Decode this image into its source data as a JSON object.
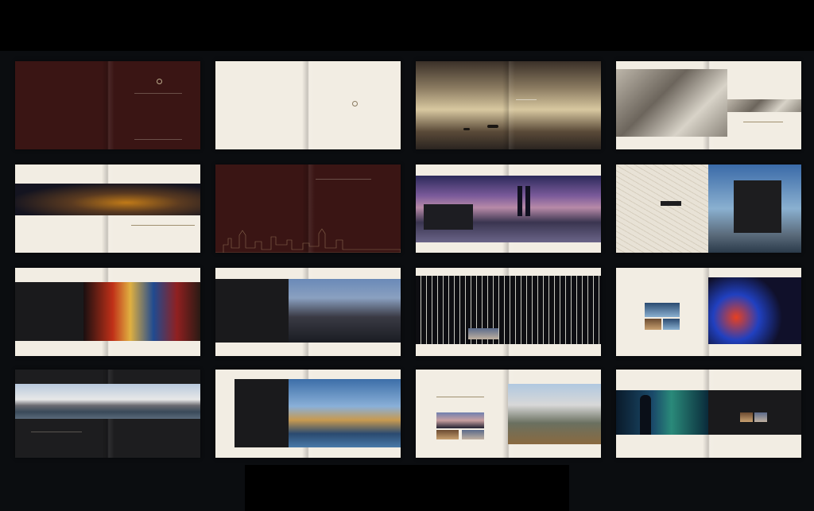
{
  "layout": {
    "background": "#0b0d10",
    "columns": 4,
    "rows": 4
  },
  "colors": {
    "cream": "#f2ede3",
    "maroon": "#3a1514",
    "dark_panel": "#1d1d1f",
    "gold": "#b9a98a"
  },
  "spreads": [
    {
      "id": "cover",
      "style": "maroon",
      "captions": []
    },
    {
      "id": "blank-logo",
      "style": "cream",
      "captions": []
    },
    {
      "id": "river-sunset",
      "style": "photo",
      "captions": []
    },
    {
      "id": "historic-collage",
      "style": "cream",
      "captions": []
    },
    {
      "id": "night-bridge",
      "style": "cream",
      "captions": []
    },
    {
      "id": "maroon-skyline",
      "style": "maroon",
      "captions": []
    },
    {
      "id": "twin-towers",
      "style": "cream",
      "captions": []
    },
    {
      "id": "map-city",
      "style": "cream",
      "captions": []
    },
    {
      "id": "times-square",
      "style": "cream",
      "captions": []
    },
    {
      "id": "towers-day",
      "style": "cream",
      "captions": []
    },
    {
      "id": "office-night",
      "style": "cream",
      "captions": []
    },
    {
      "id": "light-trails",
      "style": "cream",
      "captions": []
    },
    {
      "id": "skyline-panorama",
      "style": "dark",
      "captions": []
    },
    {
      "id": "island-city",
      "style": "cream",
      "captions": []
    },
    {
      "id": "park-city",
      "style": "cream",
      "captions": []
    },
    {
      "id": "data-wall",
      "style": "cream",
      "captions": []
    }
  ],
  "icons": {
    "brand_mark": "circle-logo-icon"
  }
}
